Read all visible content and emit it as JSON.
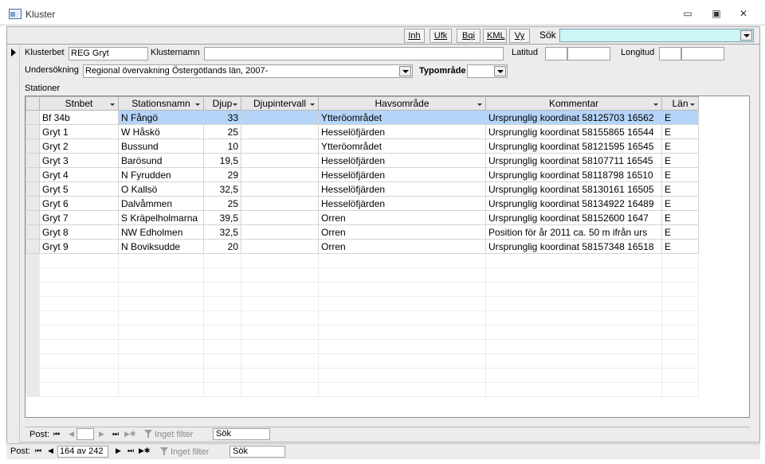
{
  "window": {
    "title": "Kluster",
    "minimize_glyph": "▭",
    "maximize_glyph": "▣",
    "close_glyph": "✕"
  },
  "toolbar": {
    "buttons": [
      "Inh",
      "Ufk",
      "Bqi",
      "KML",
      "Vy"
    ],
    "search_label": "Sök",
    "search_value": ""
  },
  "form": {
    "klusterbet_label": "Klusterbet",
    "klusterbet_value": "REG Gryt",
    "klusternamn_label": "Klusternamn",
    "klusternamn_value": "",
    "latitud_label": "Latitud",
    "latitud_deg": "",
    "latitud_min": "",
    "longitud_label": "Longitud",
    "longitud_deg": "",
    "longitud_min": "",
    "undersokning_label": "Undersökning",
    "undersokning_value": "Regional övervakning Östergötlands län, 2007-",
    "typomrade_label": "Typområde",
    "typomrade_value": "",
    "stationer_label": "Stationer"
  },
  "grid": {
    "columns": [
      "Stnbet",
      "Stationsnamn",
      "Djup",
      "Djupintervall",
      "Havsområde",
      "Kommentar",
      "Län"
    ],
    "rows": [
      [
        "Bf 34b",
        "N Fångö",
        "33",
        "",
        "Ytteröområdet",
        "Ursprunglig koordinat 58125703 16562",
        "E"
      ],
      [
        "Gryt 1",
        "W Håskö",
        "25",
        "",
        "Hesselöfjärden",
        "Ursprunglig koordinat 58155865 16544",
        "E"
      ],
      [
        "Gryt 2",
        "Bussund",
        "10",
        "",
        "Ytteröområdet",
        "Ursprunglig koordinat 58121595 16545",
        "E"
      ],
      [
        "Gryt 3",
        "Barösund",
        "19,5",
        "",
        "Hesselöfjärden",
        "Ursprunglig koordinat 58107711 16545",
        "E"
      ],
      [
        "Gryt 4",
        "N Fyrudden",
        "29",
        "",
        "Hesselöfjärden",
        "Ursprunglig koordinat 58118798 16510",
        "E"
      ],
      [
        "Gryt 5",
        "O Kallsö",
        "32,5",
        "",
        "Hesselöfjärden",
        "Ursprunglig koordinat 58130161 16505",
        "E"
      ],
      [
        "Gryt 6",
        "Dalvåmmen",
        "25",
        "",
        "Hesselöfjärden",
        "Ursprunglig koordinat 58134922 16489",
        "E"
      ],
      [
        "Gryt 7",
        "S Kräpelholmarna",
        "39,5",
        "",
        "Orren",
        "Ursprunglig koordinat 58152600 1647",
        "E"
      ],
      [
        "Gryt 8",
        "NW Edholmen",
        "32,5",
        "",
        "Orren",
        "Position för år 2011 ca. 50 m ifrån urs",
        "E"
      ],
      [
        "Gryt 9",
        "N Boviksudde",
        "20",
        "",
        "Orren",
        "Ursprunglig koordinat 58157348 16518",
        "E"
      ]
    ]
  },
  "subform_nav": {
    "post_label": "Post:",
    "record_value": "",
    "filter_label": "Inget filter",
    "search_value": "Sök"
  },
  "main_nav": {
    "post_label": "Post:",
    "record_value": "164 av 242",
    "filter_label": "Inget filter",
    "search_value": "Sök"
  },
  "colors": {
    "search_bg": "#ccf5f5",
    "current_row": "#b5d4f7",
    "form_bg": "#ececec"
  },
  "icons": [
    "form-icon",
    "record-selector-arrow",
    "dropdown-arrow",
    "first-record-icon",
    "previous-record-icon",
    "next-record-icon",
    "last-record-icon",
    "new-record-icon",
    "filter-icon"
  ]
}
